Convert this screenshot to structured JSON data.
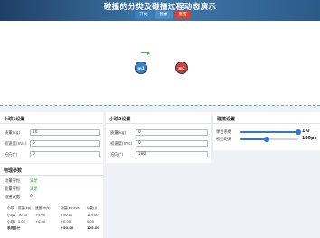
{
  "header": {
    "title": "碰撞的分类及碰撞过程动态演示",
    "buttons": {
      "start": "开始",
      "pause": "暂停",
      "reset": "重置"
    }
  },
  "stage": {
    "ball1_label": "m1",
    "ball2_label": "m2"
  },
  "ball1_panel": {
    "title": "小球1设置",
    "fields": [
      {
        "label": "质量(kg)",
        "value": "10"
      },
      {
        "label": "初速度(m/s)",
        "value": "5"
      },
      {
        "label": "方向(°)",
        "value": "0"
      }
    ]
  },
  "ball2_panel": {
    "title": "小球2设置",
    "fields": [
      {
        "label": "质量(kg)",
        "value": "0"
      },
      {
        "label": "初速度(m/s)",
        "value": "0"
      },
      {
        "label": "方向(°)",
        "value": "180"
      }
    ]
  },
  "collision_panel": {
    "title": "碰撞设置",
    "sliders": [
      {
        "label": "弹性系数",
        "value_text": "1.0",
        "level": 1.0
      },
      {
        "label": "初始距离",
        "value_text": "100px",
        "level": 0.45
      }
    ]
  },
  "physics_panel": {
    "title": "物理参数",
    "rows": [
      {
        "label": "动量守恒",
        "value": "满足",
        "color": "#2e9d3a"
      },
      {
        "label": "能量守恒",
        "value": "满足",
        "color": "#2e9d3a"
      },
      {
        "label": "碰撞次数",
        "value": "0",
        "color": "#333333"
      }
    ],
    "table": {
      "headers": [
        "小球",
        "质量(kg)",
        "速度(m/s)",
        "动量(kg·m/s)",
        "动能(J)"
      ],
      "rows": [
        [
          "小球1",
          "10.00",
          "+5.00",
          "+50.00",
          "125.00"
        ],
        [
          "小球2",
          "0.00",
          "+0.00",
          "+0.00",
          "0.00"
        ]
      ],
      "total": [
        "系统总计",
        "",
        "",
        "+50.00",
        "125.00"
      ]
    }
  }
}
